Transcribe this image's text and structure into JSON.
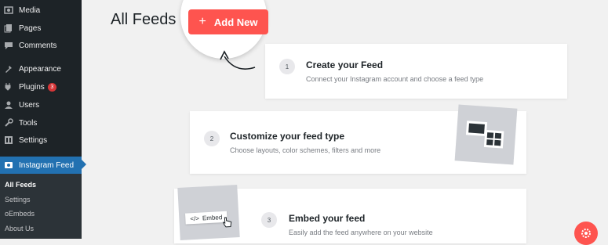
{
  "sidebar": {
    "items": [
      {
        "label": "Media",
        "icon": "media-icon"
      },
      {
        "label": "Pages",
        "icon": "pages-icon"
      },
      {
        "label": "Comments",
        "icon": "comments-icon"
      },
      {
        "label": "Appearance",
        "icon": "appearance-icon"
      },
      {
        "label": "Plugins",
        "icon": "plugins-icon",
        "badge": "3"
      },
      {
        "label": "Users",
        "icon": "users-icon"
      },
      {
        "label": "Tools",
        "icon": "tools-icon"
      },
      {
        "label": "Settings",
        "icon": "settings-icon"
      },
      {
        "label": "Instagram Feed",
        "icon": "instagram-icon"
      }
    ],
    "submenu": [
      "All Feeds",
      "Settings",
      "oEmbeds",
      "About Us"
    ]
  },
  "header": {
    "title": "All Feeds",
    "add_new": "Add New",
    "plus": "+"
  },
  "steps": [
    {
      "num": "1",
      "title": "Create your Feed",
      "desc": "Connect your Instagram account and choose a feed type"
    },
    {
      "num": "2",
      "title": "Customize your feed type",
      "desc": "Choose layouts, color schemes, filters and more"
    },
    {
      "num": "3",
      "title": "Embed your feed",
      "desc": "Easily add the feed anywhere on your website"
    }
  ],
  "embed_chip": {
    "code": "</>",
    "label": "Embed"
  },
  "colors": {
    "accent": "#fe544f",
    "sidebar": "#1d2327",
    "active": "#2271b1"
  }
}
